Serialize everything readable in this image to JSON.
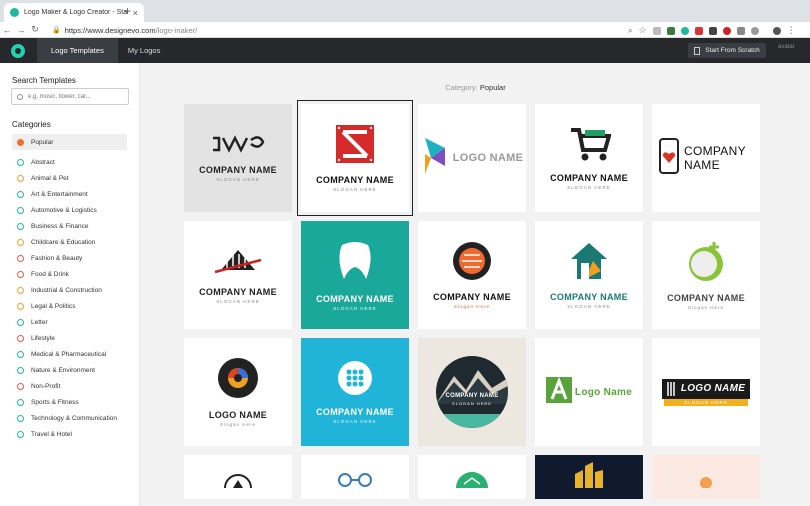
{
  "browser": {
    "tab_title": "Logo Maker & Logo Creator - Sta",
    "url_host": "https://www.designevo.com",
    "url_path": "/logo-maker/"
  },
  "app": {
    "tabs": [
      {
        "label": "Logo Templates"
      },
      {
        "label": "My Logos"
      }
    ],
    "start_button": "Start From Scratch",
    "avatar_alt": "avatar"
  },
  "sidebar": {
    "search_heading": "Search Templates",
    "search_placeholder": "e.g. music, flower, car...",
    "categories_heading": "Categories",
    "categories": [
      "Popular",
      "Abstract",
      "Animal & Pet",
      "Art & Entertainment",
      "Automotive & Logistics",
      "Business & Finance",
      "Childcare & Education",
      "Fashion & Beauty",
      "Food & Drink",
      "Industrial & Construction",
      "Legal & Politics",
      "Letter",
      "Lifestyle",
      "Medical & Pharmaceutical",
      "Nature & Environment",
      "Non-Profit",
      "Sports & Fitness",
      "Technology & Communication",
      "Travel & Hotel"
    ]
  },
  "main": {
    "category_label": "Category:",
    "category_value": "Popular",
    "cards": [
      {
        "name": "COMPANY NAME",
        "slogan": "SLOGAN HERE",
        "bg": "#e3e3e3",
        "color": "#222"
      },
      {
        "name": "COMPANY NAME",
        "slogan": "SLOGAN HERE",
        "bg": "#ffffff",
        "color": "#111"
      },
      {
        "name": "LOGO NAME",
        "slogan": "",
        "bg": "#ffffff",
        "color": "#999"
      },
      {
        "name": "COMPANY NAME",
        "slogan": "SLOGAN HERE",
        "bg": "#ffffff",
        "color": "#111"
      },
      {
        "name": "COMPANY NAME",
        "slogan": "",
        "bg": "#ffffff",
        "color": "#111"
      },
      {
        "name": "COMPANY NAME",
        "slogan": "SLOGAN HERE",
        "bg": "#ffffff",
        "color": "#222"
      },
      {
        "name": "COMPANY NAME",
        "slogan": "SLOGAN HERE",
        "bg": "#1aa89a",
        "color": "#ffffff"
      },
      {
        "name": "COMPANY NAME",
        "slogan": "Slogan Here",
        "bg": "#ffffff",
        "color": "#111"
      },
      {
        "name": "COMPANY NAME",
        "slogan": "SLOGAN HERE",
        "bg": "#ffffff",
        "color": "#1a7a73"
      },
      {
        "name": "COMPANY NAME",
        "slogan": "Slogan Here",
        "bg": "#ffffff",
        "color": "#444"
      },
      {
        "name": "LOGO NAME",
        "slogan": "Slogan Here",
        "bg": "#ffffff",
        "color": "#222"
      },
      {
        "name": "COMPANY NAME",
        "slogan": "SLOGAN HERE",
        "bg": "#20b4d8",
        "color": "#ffffff"
      },
      {
        "name": "COMPANY NAME",
        "slogan": "SLOGAN HERE",
        "bg": "#ece8e0",
        "color": "#ffffff"
      },
      {
        "name": "Logo Name",
        "slogan": "",
        "bg": "#ffffff",
        "color": "#5aa33a"
      },
      {
        "name": "LOGO NAME",
        "slogan": "SLOGAN HERE",
        "bg": "#ffffff",
        "color": "#ffffff"
      },
      {
        "name": "",
        "slogan": "",
        "bg": "#ffffff",
        "color": "#222"
      },
      {
        "name": "",
        "slogan": "",
        "bg": "#ffffff",
        "color": "#222"
      },
      {
        "name": "",
        "slogan": "",
        "bg": "#ffffff",
        "color": "#222"
      },
      {
        "name": "",
        "slogan": "",
        "bg": "#0f1a2e",
        "color": "#fff"
      },
      {
        "name": "",
        "slogan": "",
        "bg": "#fbe9e2",
        "color": "#222"
      }
    ]
  }
}
